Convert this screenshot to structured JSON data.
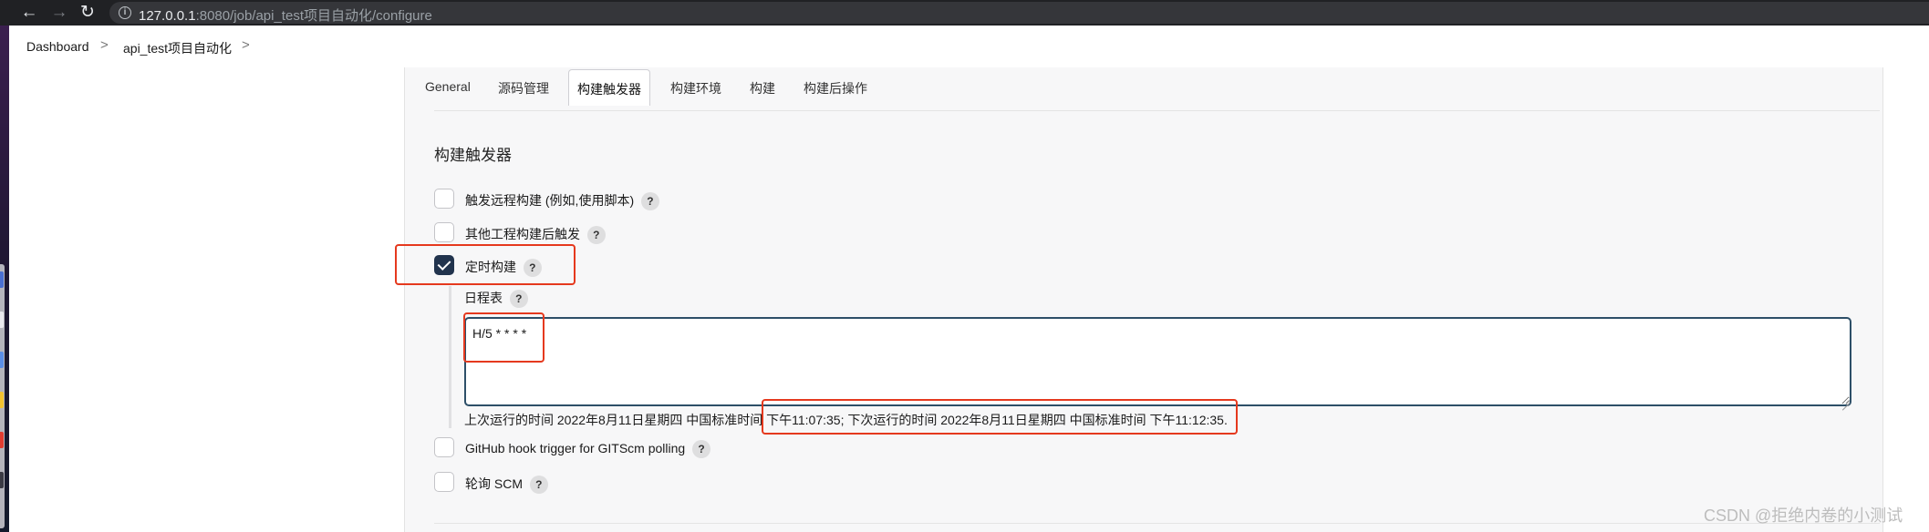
{
  "browser": {
    "url_host": "127.0.0.1",
    "url_rest": ":8080/job/api_test项目自动化/configure"
  },
  "breadcrumb": {
    "items": [
      "Dashboard",
      "api_test项目自动化"
    ],
    "separator": ">"
  },
  "tabs": [
    "General",
    "源码管理",
    "构建触发器",
    "构建环境",
    "构建",
    "构建后操作"
  ],
  "active_tab": "构建触发器",
  "section_title": "构建触发器",
  "triggers": [
    {
      "label": "触发远程构建 (例如,使用脚本)",
      "checked": false
    },
    {
      "label": "其他工程构建后触发",
      "checked": false
    },
    {
      "label": "定时构建",
      "checked": true
    },
    {
      "label": "GitHub hook trigger for GITScm polling",
      "checked": false
    },
    {
      "label": "轮询 SCM",
      "checked": false
    }
  ],
  "schedule": {
    "label": "日程表",
    "value": "H/5 * * * *",
    "note": "上次运行的时间 2022年8月11日星期四 中国标准时间 下午11:07:35; 下次运行的时间 2022年8月11日星期四 中国标准时间 下午11:12:35."
  },
  "help_glyph": "?",
  "watermark": "CSDN @拒绝内卷的小测试",
  "colors": {
    "highlight": "#e5391e",
    "checkbox_checked": "#21334d",
    "input_border": "#2d4f68"
  }
}
